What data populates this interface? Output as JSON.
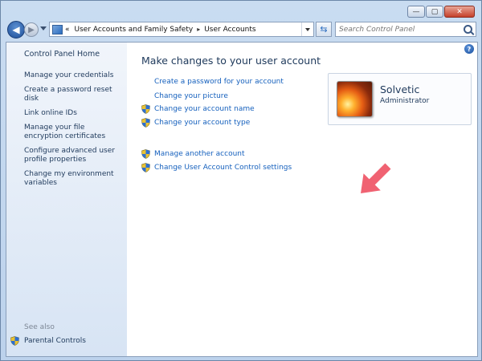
{
  "window": {
    "minimize": "—",
    "maximize": "▢",
    "close": "✕"
  },
  "address": {
    "overflow": "«",
    "crumbs": [
      "User Accounts and Family Safety",
      "User Accounts"
    ],
    "separator": "▸"
  },
  "search": {
    "placeholder": "Search Control Panel"
  },
  "sidebar": {
    "home": "Control Panel Home",
    "links": [
      "Manage your credentials",
      "Create a password reset disk",
      "Link online IDs",
      "Manage your file encryption certificates",
      "Configure advanced user profile properties",
      "Change my environment variables"
    ],
    "see_also": "See also",
    "parental": "Parental Controls"
  },
  "main": {
    "heading": "Make changes to your user account",
    "tasks": [
      {
        "label": "Create a password for your account",
        "icon": "none"
      },
      {
        "label": "Change your picture",
        "icon": "none"
      },
      {
        "label": "Change your account name",
        "icon": "shield-icon"
      },
      {
        "label": "Change your account type",
        "icon": "shield-icon"
      },
      {
        "label": "Manage another account",
        "icon": "shield-icon"
      },
      {
        "label": "Change User Account Control settings",
        "icon": "shield-icon"
      }
    ],
    "help": "?"
  },
  "user": {
    "name": "Solvetic",
    "role": "Administrator"
  },
  "colors": {
    "link": "#1560bd",
    "arrow": "#f06272",
    "heading": "#1e395b"
  }
}
